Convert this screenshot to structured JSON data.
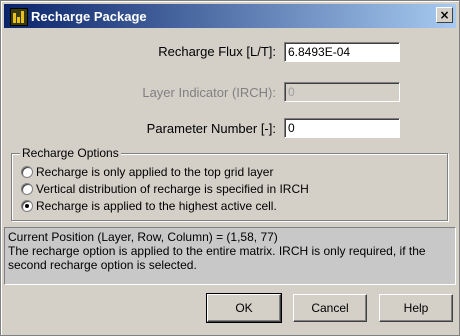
{
  "window": {
    "title": "Recharge Package",
    "close_glyph": "×"
  },
  "fields": {
    "recharge_flux": {
      "label": "Recharge Flux [L/T]:",
      "value": "6.8493E-04"
    },
    "layer_indicator": {
      "label": "Layer Indicator (IRCH):",
      "value": "0"
    },
    "parameter_number": {
      "label": "Parameter Number [-]:",
      "value": "0"
    }
  },
  "recharge_options": {
    "title": "Recharge Options",
    "options": [
      {
        "label": "Recharge is only applied to the top grid layer",
        "selected": false
      },
      {
        "label": "Vertical distribution of recharge is specified in IRCH",
        "selected": false
      },
      {
        "label": "Recharge is applied to the highest active cell.",
        "selected": true
      }
    ]
  },
  "info": {
    "line1": "Current Position (Layer, Row, Column) = (1,58, 77)",
    "line2": "The recharge option is applied to the entire matrix. IRCH is only required, if the second recharge option is selected."
  },
  "buttons": {
    "ok": "OK",
    "cancel": "Cancel",
    "help": "Help"
  }
}
